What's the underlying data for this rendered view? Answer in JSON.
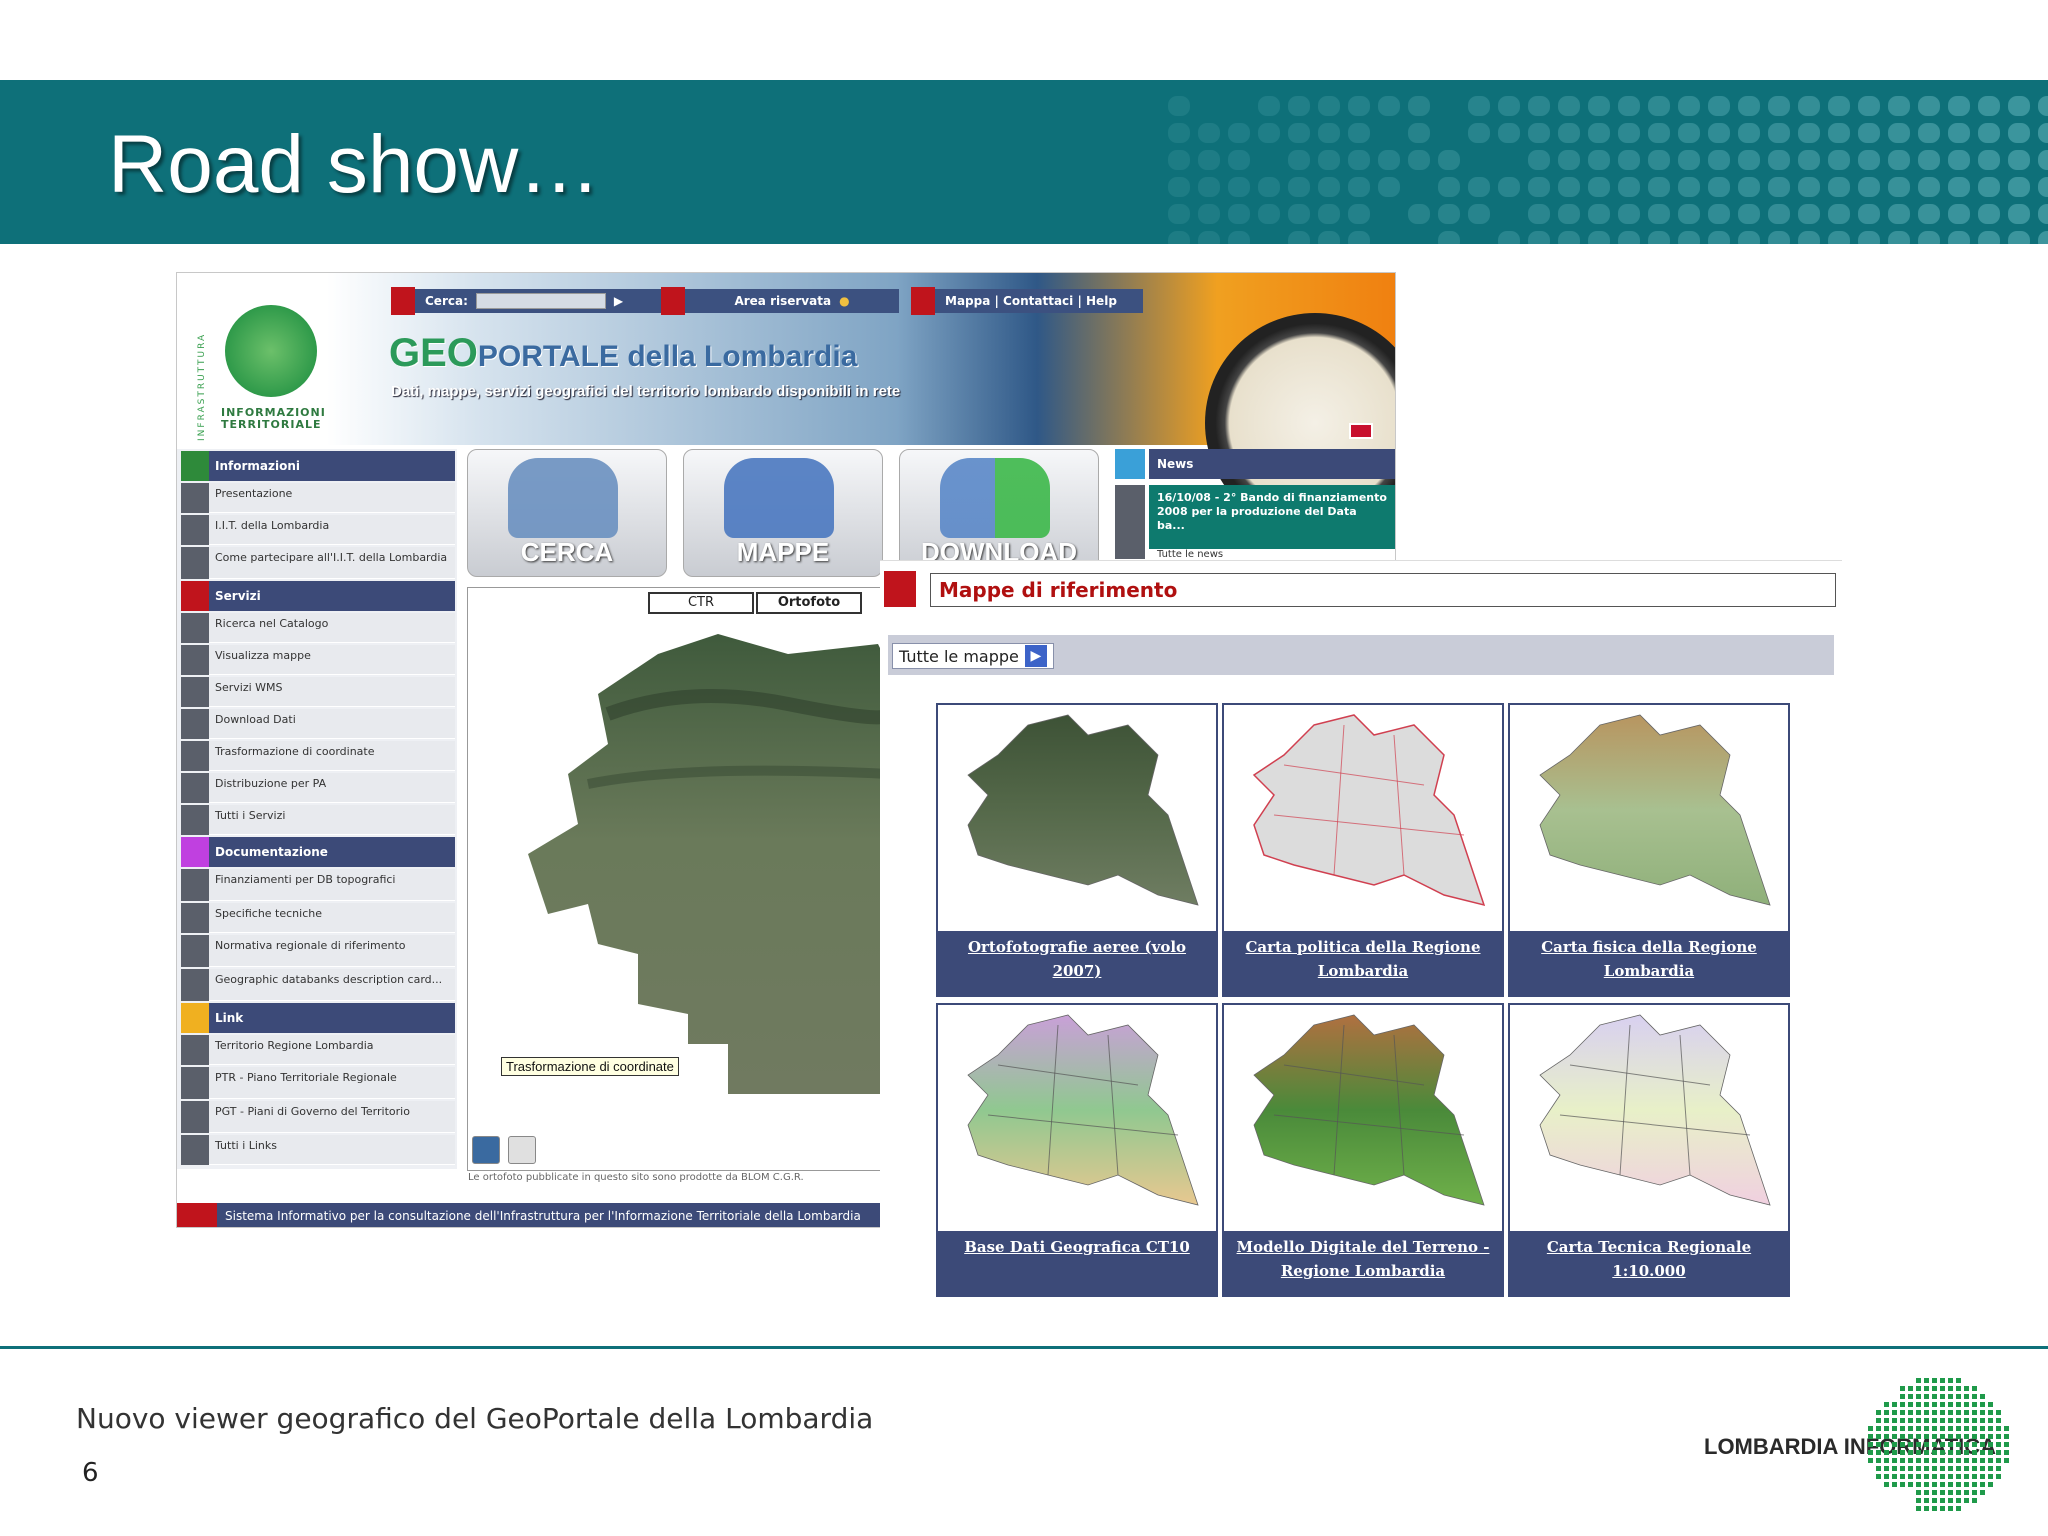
{
  "slide": {
    "title": "Road show…",
    "footer_text": "Nuovo viewer geografico del GeoPortale della Lombardia",
    "page_number": "6",
    "brand_logo_text": "LOMBARDIA INFORMATICA",
    "colors": {
      "band": "#0e7079",
      "nav_blue": "#3c4a78",
      "red": "#c0141c"
    }
  },
  "geoportal": {
    "logo_side_text": "INFRASTRUTTURA",
    "logo_text": "INFORMAZIONI TERRITORIALE",
    "search_label": "Cerca:",
    "area_riservata": "Area riservata",
    "top_links": "Mappa | Contattaci | Help",
    "title_geo": "GEO",
    "title_rest": "PORTALE della Lombardia",
    "subtitle": "Dati, mappe, servizi geografici del territorio lombardo disponibili in rete",
    "menu": [
      {
        "type": "head",
        "label": "Informazioni",
        "color": "green"
      },
      {
        "type": "item",
        "label": "Presentazione"
      },
      {
        "type": "item",
        "label": "I.I.T. della Lombardia"
      },
      {
        "type": "item",
        "label": "Come partecipare all'I.I.T. della Lombardia"
      },
      {
        "type": "head",
        "label": "Servizi",
        "color": "crimson"
      },
      {
        "type": "item",
        "label": "Ricerca nel Catalogo"
      },
      {
        "type": "item",
        "label": "Visualizza mappe"
      },
      {
        "type": "item",
        "label": "Servizi WMS"
      },
      {
        "type": "item",
        "label": "Download Dati"
      },
      {
        "type": "item",
        "label": "Trasformazione di coordinate"
      },
      {
        "type": "item",
        "label": "Distribuzione per PA"
      },
      {
        "type": "item",
        "label": "Tutti i Servizi"
      },
      {
        "type": "head",
        "label": "Documentazione",
        "color": "purple"
      },
      {
        "type": "item",
        "label": "Finanziamenti per DB topografici"
      },
      {
        "type": "item",
        "label": "Specifiche tecniche"
      },
      {
        "type": "item",
        "label": "Normativa regionale di riferimento"
      },
      {
        "type": "item",
        "label": "Geographic databanks description card..."
      },
      {
        "type": "head",
        "label": "Link",
        "color": "orange"
      },
      {
        "type": "item",
        "label": "Territorio Regione Lombardia"
      },
      {
        "type": "item",
        "label": "PTR - Piano Territoriale Regionale"
      },
      {
        "type": "item",
        "label": "PGT - Piani di Governo del Territorio"
      },
      {
        "type": "item",
        "label": "Tutti i Links"
      }
    ],
    "tiles": [
      "CERCA",
      "MAPPE",
      "DOWNLOAD"
    ],
    "news_head": "News",
    "news_body": "16/10/08 - 2° Bando di finanziamento 2008 per la produzione del Data ba...",
    "news_more": "Tutte le news",
    "map_tabs": [
      "CTR",
      "Ortofoto"
    ],
    "map_credit": "Le ortofoto pubblicate in questo sito sono prodotte da BLOM C.G.R.",
    "tooltip": "Trasformazione di coordinate",
    "footer": "Sistema Informativo per la consultazione dell'Infrastruttura per l'Informazione Territoriale della Lombardia"
  },
  "overlay": {
    "title": "Mappe di riferimento",
    "all_maps": "Tutte le mappe",
    "cards": [
      {
        "caption": "Ortofotografie aeree (volo 2007)",
        "style": "ortho"
      },
      {
        "caption": "Carta politica della Regione Lombardia",
        "style": "political"
      },
      {
        "caption": "Carta fisica della Regione Lombardia",
        "style": "physical"
      },
      {
        "caption": "Base Dati Geografica CT10",
        "style": "ct10"
      },
      {
        "caption": "Modello Digitale del Terreno - Regione Lombardia",
        "style": "dtm"
      },
      {
        "caption": "Carta Tecnica Regionale 1:10.000",
        "style": "ctr"
      }
    ]
  }
}
